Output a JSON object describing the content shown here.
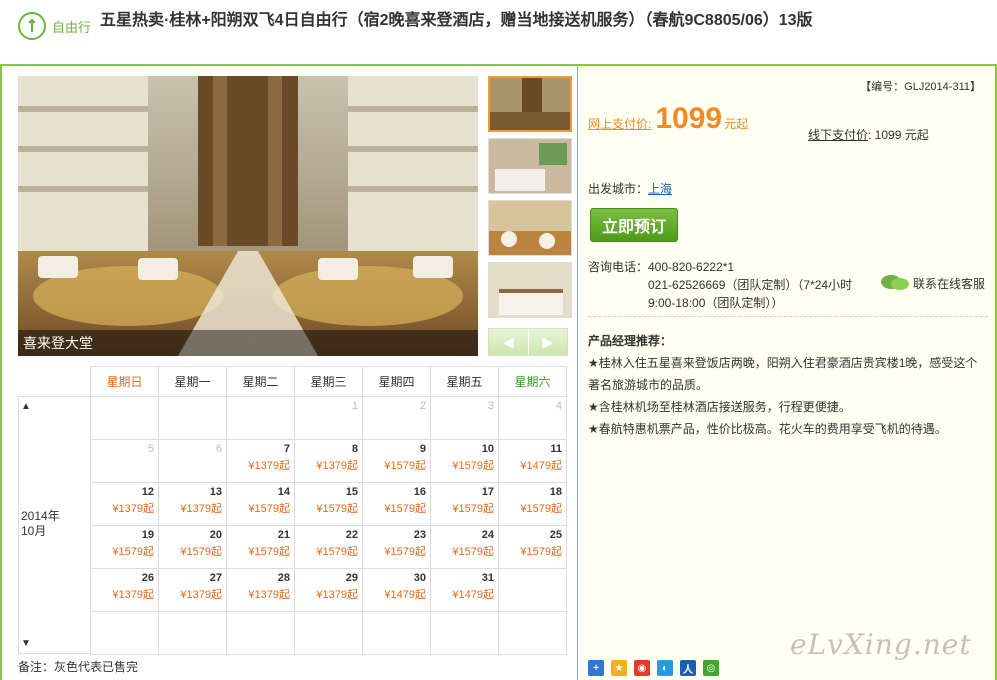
{
  "header": {
    "badge_label": "自由行",
    "title": "五星热卖·桂林+阳朔双飞4日自由行（宿2晚喜来登酒店，赠当地接送机服务）（春航9C8805/06）13版"
  },
  "gallery": {
    "caption": "喜来登大堂",
    "nav_prev": "◀",
    "nav_next": "▶"
  },
  "calendar": {
    "weekdays": [
      "星期日",
      "星期一",
      "星期二",
      "星期三",
      "星期四",
      "星期五",
      "星期六"
    ],
    "year_label": "2014年",
    "month_label": "10月",
    "up": "▲",
    "down": "▼",
    "rows": [
      [
        {
          "d": ""
        },
        {
          "d": ""
        },
        {
          "d": ""
        },
        {
          "d": "1",
          "g": true
        },
        {
          "d": "2",
          "g": true
        },
        {
          "d": "3",
          "g": true
        },
        {
          "d": "4",
          "g": true
        }
      ],
      [
        {
          "d": "5",
          "g": true
        },
        {
          "d": "6",
          "g": true
        },
        {
          "d": "7",
          "p": "¥1379起"
        },
        {
          "d": "8",
          "p": "¥1379起"
        },
        {
          "d": "9",
          "p": "¥1579起"
        },
        {
          "d": "10",
          "p": "¥1579起"
        },
        {
          "d": "11",
          "p": "¥1479起"
        }
      ],
      [
        {
          "d": "12",
          "p": "¥1379起"
        },
        {
          "d": "13",
          "p": "¥1379起"
        },
        {
          "d": "14",
          "p": "¥1579起"
        },
        {
          "d": "15",
          "p": "¥1579起"
        },
        {
          "d": "16",
          "p": "¥1579起"
        },
        {
          "d": "17",
          "p": "¥1579起"
        },
        {
          "d": "18",
          "p": "¥1579起"
        }
      ],
      [
        {
          "d": "19",
          "p": "¥1579起"
        },
        {
          "d": "20",
          "p": "¥1579起"
        },
        {
          "d": "21",
          "p": "¥1579起"
        },
        {
          "d": "22",
          "p": "¥1579起"
        },
        {
          "d": "23",
          "p": "¥1579起"
        },
        {
          "d": "24",
          "p": "¥1579起"
        },
        {
          "d": "25",
          "p": "¥1579起"
        }
      ],
      [
        {
          "d": "26",
          "p": "¥1379起"
        },
        {
          "d": "27",
          "p": "¥1379起"
        },
        {
          "d": "28",
          "p": "¥1379起"
        },
        {
          "d": "29",
          "p": "¥1379起"
        },
        {
          "d": "30",
          "p": "¥1479起"
        },
        {
          "d": "31",
          "p": "¥1479起"
        },
        {
          "d": ""
        }
      ],
      [
        {
          "d": ""
        },
        {
          "d": ""
        },
        {
          "d": ""
        },
        {
          "d": ""
        },
        {
          "d": ""
        },
        {
          "d": ""
        },
        {
          "d": ""
        }
      ]
    ],
    "note": "备注：灰色代表已售完"
  },
  "booking": {
    "code": "【编号：GLJ2014-311】",
    "online_label": "网上支付价:",
    "online_price": "1099",
    "online_unit": "元起",
    "offline_label": "线下支付价",
    "offline_value": ":  1099 元起",
    "city_label": "出发城市：",
    "city_value": "上海",
    "book_button": "立即预订",
    "contact_label": "咨询电话：",
    "contact_lines": [
      "400-820-6222*1",
      "021-62526669（团队定制）（7*24小时",
      "9:00-18:00（团队定制））"
    ],
    "service_label": "联系在线客服"
  },
  "recommend": {
    "title": "产品经理推荐：",
    "items": [
      "★桂林入住五星喜来登饭店两晚，阳朔入住君豪酒店贵宾楼1晚，感受这个著名旅游城市的品质。",
      "★含桂林机场至桂林酒店接送服务，行程更便捷。",
      "★春航特惠机票产品，性价比极高。花火车的费用享受飞机的待遇。"
    ]
  },
  "share_icons": [
    "plus-share",
    "qzone",
    "weibo",
    "tencent-weibo",
    "renren",
    "wechat"
  ],
  "watermark": "eLvXing.net"
}
